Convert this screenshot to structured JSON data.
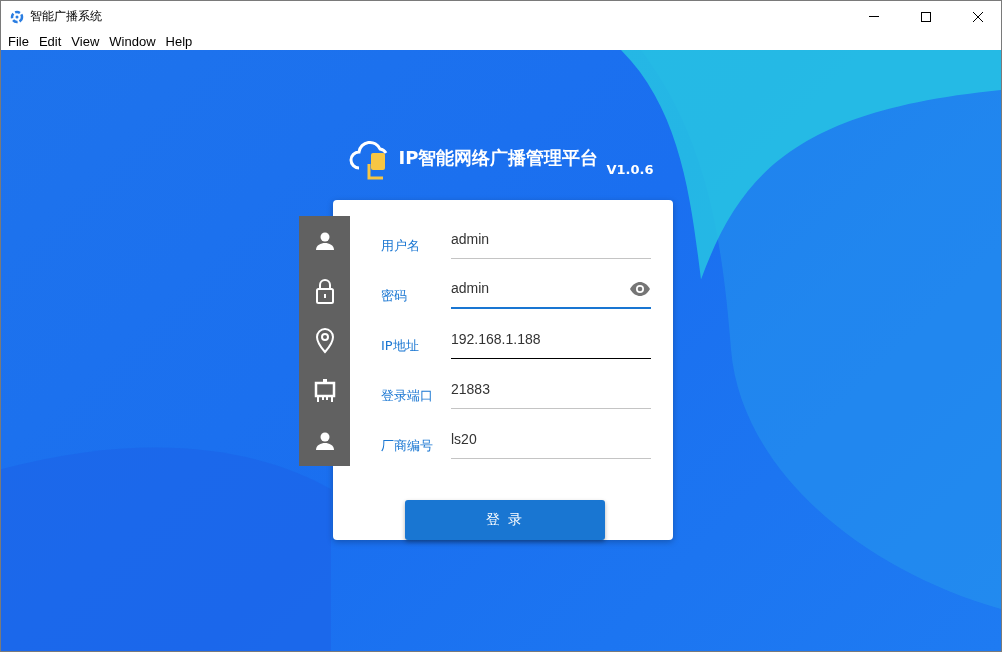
{
  "window": {
    "title": "智能广播系统"
  },
  "menu": [
    "File",
    "Edit",
    "View",
    "Window",
    "Help"
  ],
  "logo": {
    "title": "IP智能网络广播管理平台",
    "version": "V1.0.6"
  },
  "fields": [
    {
      "kind": "person",
      "label": "用户名",
      "value": "admin",
      "focused": false,
      "hovered": false
    },
    {
      "kind": "lock",
      "label": "密码",
      "value": "admin",
      "focused": true,
      "hovered": false,
      "reveal_toggle": true
    },
    {
      "kind": "pin",
      "label": "IP地址",
      "value": "192.168.1.188",
      "focused": false,
      "hovered": true
    },
    {
      "kind": "easel",
      "label": "登录端口",
      "value": "21883",
      "focused": false,
      "hovered": false
    },
    {
      "kind": "person",
      "label": "厂商编号",
      "value": "ls20",
      "focused": false,
      "hovered": false
    }
  ],
  "login_button": "登 录"
}
